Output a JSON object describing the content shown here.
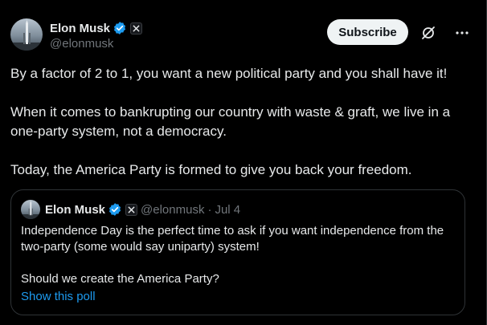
{
  "author": {
    "display_name": "Elon Musk",
    "handle": "@elonmusk",
    "verified_icon": "verified-badge-icon",
    "affiliation_icon": "x-logo-icon"
  },
  "actions": {
    "subscribe_label": "Subscribe",
    "grok_icon": "grok-icon",
    "more_icon": "more-icon"
  },
  "post": {
    "paragraphs": [
      "By a factor of 2 to 1, you want a new political party and you shall have it!",
      "When it comes to bankrupting our country with waste & graft, we live in a one-party system, not a democracy.",
      "Today, the America Party is formed to give you back your freedom."
    ]
  },
  "quote": {
    "display_name": "Elon Musk",
    "handle": "@elonmusk",
    "separator": "·",
    "date": "Jul 4",
    "paragraphs": [
      "Independence Day is the perfect time to ask if you want independence from the two-party (some would say uniparty) system!",
      "Should we create the America Party?"
    ],
    "poll_link": "Show this poll"
  },
  "colors": {
    "background": "#000000",
    "text": "#e7e9ea",
    "muted": "#71767b",
    "accent": "#1d9bf0",
    "border": "#2f3336"
  }
}
